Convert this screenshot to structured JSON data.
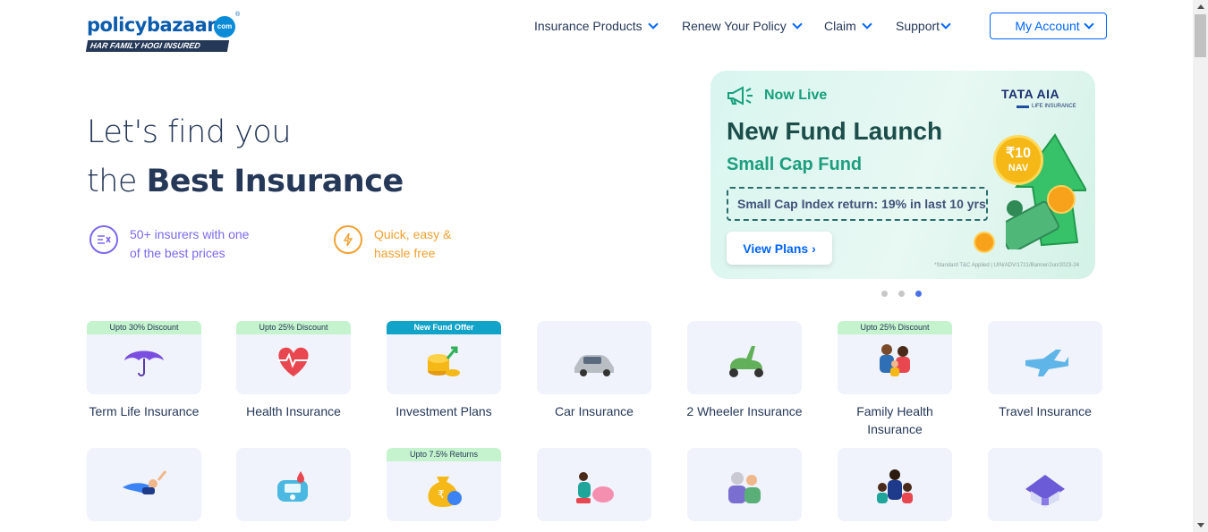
{
  "header": {
    "logo_word": "policybazaar",
    "logo_com": "com",
    "logo_reg": "®",
    "logo_tagline": "HAR FAMILY HOGI INSURED",
    "nav": [
      "Insurance Products",
      "Renew Your Policy",
      "Claim",
      "Support"
    ],
    "account_label": "My Account"
  },
  "hero": {
    "line1": "Let's find you",
    "line2_prefix": "the ",
    "line2_bold": "Best Insurance",
    "features": [
      {
        "text": "50+ insurers with one of the best prices",
        "icon": "compare-icon",
        "color": "#7b68ee"
      },
      {
        "text": "Quick, easy & hassle free",
        "icon": "lightning-icon",
        "color": "#f0a12e"
      }
    ]
  },
  "banner": {
    "live_label": "Now Live",
    "brand": "TATA AIA",
    "brand_sub": "LIFE INSURANCE",
    "title": "New Fund Launch",
    "subtitle": "Small Cap Fund",
    "highlight": "Small Cap Index return: 19% in last 10 yrs",
    "cta": "View Plans",
    "cta_arrow": "›",
    "coin_value": "₹10",
    "coin_label": "NAV",
    "fine_print": "*Standard T&C Applied | UIN/ADV/1721/Banner/Jun/2023-24",
    "slides": 3,
    "active_slide": 3
  },
  "products": [
    {
      "label": "Term Life Insurance",
      "badge": "Upto 30% Discount",
      "badge_style": "green",
      "icon": "umbrella-icon"
    },
    {
      "label": "Health Insurance",
      "badge": "Upto 25% Discount",
      "badge_style": "green",
      "icon": "heart-pulse-icon"
    },
    {
      "label": "Investment Plans",
      "badge": "New Fund Offer",
      "badge_style": "teal",
      "icon": "coins-growth-icon"
    },
    {
      "label": "Car Insurance",
      "badge": "",
      "badge_style": "",
      "icon": "car-icon"
    },
    {
      "label": "2 Wheeler Insurance",
      "badge": "",
      "badge_style": "",
      "icon": "scooter-icon"
    },
    {
      "label": "Family Health Insurance",
      "badge": "Upto 25% Discount",
      "badge_style": "green",
      "icon": "family-icon"
    },
    {
      "label": "Travel Insurance",
      "badge": "",
      "badge_style": "",
      "icon": "airplane-icon"
    },
    {
      "label": "",
      "badge": "",
      "badge_style": "",
      "icon": "superhero-icon"
    },
    {
      "label": "",
      "badge": "",
      "badge_style": "",
      "icon": "glucometer-icon"
    },
    {
      "label": "",
      "badge": "Upto 7.5% Returns",
      "badge_style": "green",
      "icon": "money-bag-icon"
    },
    {
      "label": "",
      "badge": "",
      "badge_style": "",
      "icon": "piggy-bank-icon"
    },
    {
      "label": "",
      "badge": "",
      "badge_style": "",
      "icon": "senior-couple-icon"
    },
    {
      "label": "",
      "badge": "",
      "badge_style": "",
      "icon": "business-people-icon"
    },
    {
      "label": "",
      "badge": "",
      "badge_style": "",
      "icon": "house-icon"
    }
  ],
  "colors": {
    "brand_blue": "#0065ff",
    "navy": "#253858",
    "banner_green": "#16a07c",
    "active_dot": "#4a70e6"
  }
}
